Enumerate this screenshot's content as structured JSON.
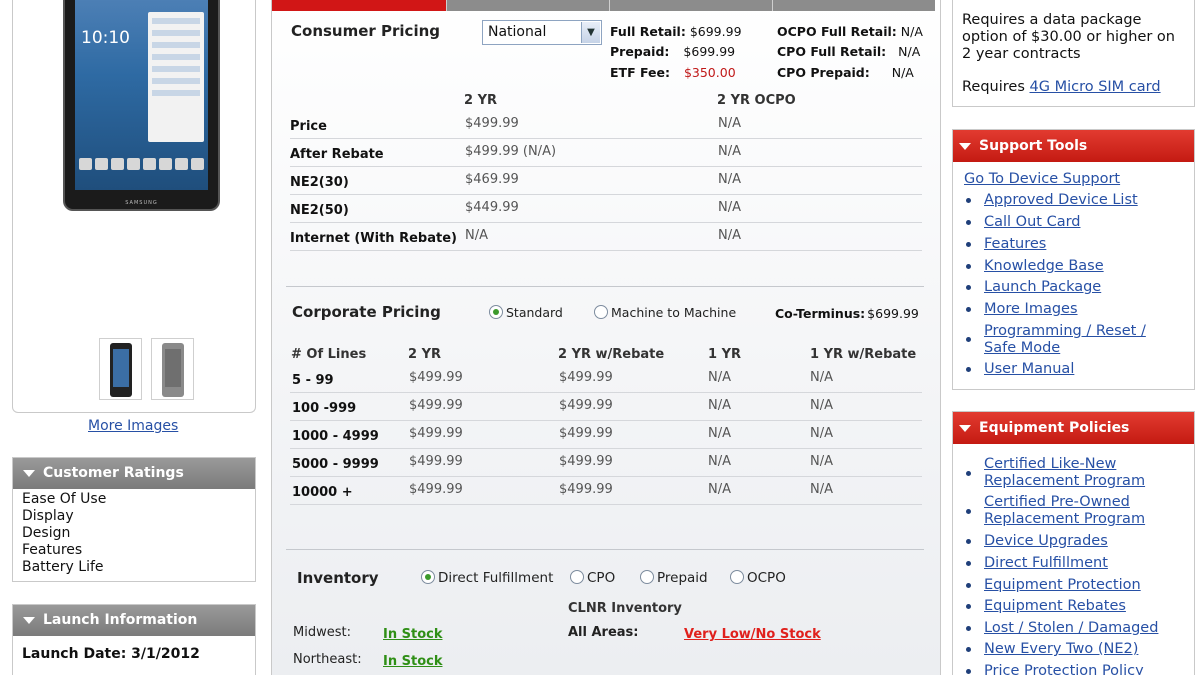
{
  "left": {
    "device_brand": "SAMSUNG",
    "device_clock": "10:10",
    "more_images": "More Images",
    "ratings": {
      "title": "Customer Ratings",
      "items": [
        "Ease Of Use",
        "Display",
        "Design",
        "Features",
        "Battery Life"
      ]
    },
    "launch": {
      "title": "Launch Information",
      "date_line": "Launch Date: 3/1/2012"
    }
  },
  "consumer": {
    "title": "Consumer Pricing",
    "region_select": "National",
    "full_retail_label": "Full Retail:",
    "full_retail_value": "$699.99",
    "prepaid_label": "Prepaid:",
    "prepaid_value": "$699.99",
    "etf_label": "ETF Fee:",
    "etf_value": "$350.00",
    "ocpo_full_retail_label": "OCPO Full Retail:",
    "ocpo_full_retail_value": "N/A",
    "cpo_full_retail_label": "CPO Full Retail:",
    "cpo_full_retail_value": "N/A",
    "cpo_prepaid_label": "CPO Prepaid:",
    "cpo_prepaid_value": "N/A",
    "columns": [
      "2 YR",
      "2 YR OCPO"
    ],
    "rows": [
      {
        "label": "Price",
        "v1": "$499.99",
        "v2": "N/A"
      },
      {
        "label": "After Rebate",
        "v1": "$499.99 (N/A)",
        "v2": "N/A"
      },
      {
        "label": "NE2(30)",
        "v1": "$469.99",
        "v2": "N/A"
      },
      {
        "label": "NE2(50)",
        "v1": "$449.99",
        "v2": "N/A"
      },
      {
        "label": "Internet (With Rebate)",
        "v1": "N/A",
        "v2": "N/A"
      }
    ]
  },
  "corporate": {
    "title": "Corporate Pricing",
    "radio_standard": "Standard",
    "radio_m2m": "Machine to Machine",
    "coterminus_label": "Co-Terminus:",
    "coterminus_value": "$699.99",
    "columns": [
      "# Of Lines",
      "2 YR",
      "2 YR w/Rebate",
      "1 YR",
      "1 YR w/Rebate"
    ],
    "rows": [
      {
        "lines": "5 - 99",
        "c1": "$499.99",
        "c2": "$499.99",
        "c3": "N/A",
        "c4": "N/A"
      },
      {
        "lines": "100 -999",
        "c1": "$499.99",
        "c2": "$499.99",
        "c3": "N/A",
        "c4": "N/A"
      },
      {
        "lines": "1000 - 4999",
        "c1": "$499.99",
        "c2": "$499.99",
        "c3": "N/A",
        "c4": "N/A"
      },
      {
        "lines": "5000 - 9999",
        "c1": "$499.99",
        "c2": "$499.99",
        "c3": "N/A",
        "c4": "N/A"
      },
      {
        "lines": "10000 +",
        "c1": "$499.99",
        "c2": "$499.99",
        "c3": "N/A",
        "c4": "N/A"
      }
    ]
  },
  "inventory": {
    "title": "Inventory",
    "radios": [
      "Direct Fulfillment",
      "CPO",
      "Prepaid",
      "OCPO"
    ],
    "clnr_heading": "CLNR Inventory",
    "midwest_label": "Midwest:",
    "midwest_status": "In Stock",
    "northeast_label": "Northeast:",
    "northeast_status": "In Stock",
    "all_areas_label": "All Areas:",
    "all_areas_status": "Very Low/No Stock"
  },
  "right": {
    "data_pkg_text": "Requires a data package option of $30.00 or higher on 2 year contracts",
    "sim_prefix": "Requires",
    "sim_link": "4G Micro SIM card",
    "support": {
      "title": "Support Tools",
      "top_link": "Go To Device Support",
      "items": [
        "Approved Device List",
        "Call Out Card",
        "Features",
        "Knowledge Base",
        "Launch Package",
        "More Images",
        "Programming / Reset / Safe Mode",
        "User Manual"
      ]
    },
    "policies": {
      "title": "Equipment Policies",
      "items": [
        "Certified Like-New Replacement Program",
        "Certified Pre-Owned Replacement Program",
        "Device Upgrades",
        "Direct Fulfillment",
        "Equipment Protection",
        "Equipment Rebates",
        "Lost / Stolen / Damaged",
        "New Every Two (NE2)",
        "Price Protection Policy"
      ]
    }
  },
  "colors": {
    "accent_red": "#d11616",
    "link_blue": "#2750a5",
    "stock_green": "#2f8f16",
    "stock_red": "#e0201c"
  }
}
